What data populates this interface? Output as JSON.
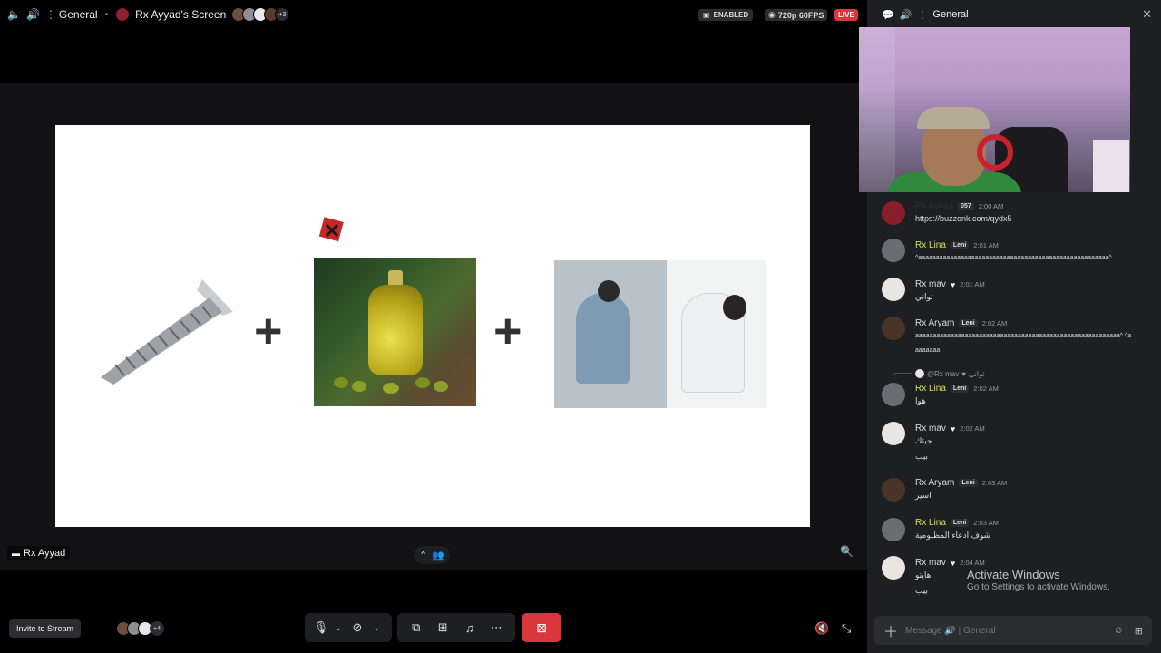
{
  "topbar": {
    "channel": "General",
    "screen_name": "Rx Ayyad's Screen",
    "viewer_extra": "+3",
    "enabled_label": "ENABLED",
    "quality_label": "720p 60FPS",
    "live_label": "LIVE"
  },
  "stage": {
    "streamer_tag": "Rx Ayyad",
    "invite_label": "Invite to Stream",
    "viewers_extra": "+4"
  },
  "chat": {
    "header_title": "General",
    "messages": [
      {
        "author": "Rx Ayyad",
        "tag": "057",
        "time": "2:00 AM",
        "body": "https://buzzonk.com/qydx5",
        "author_color": "#1e1f22",
        "body_is_link": true
      },
      {
        "author": "Rx Lina",
        "tag": "Leni",
        "time": "2:01 AM",
        "body": "^aaaaaaaaaaaaaaaaaaaaaaaaaaaaaaaaaaaaaaaaaaaaaaaaaaaaaa^",
        "author_color": "#d4e157"
      },
      {
        "author": "Rx mav",
        "heart": "♥",
        "time": "2:01 AM",
        "body": "ثواني",
        "author_color": "#dbdee1"
      },
      {
        "author": "Rx Aryam",
        "tag": "Leni",
        "time": "2:02 AM",
        "body": "aaaaaaaaaaaaaaaaaaaaaaaaaaaaaaaaaaaaaaaaaaaaaaaaaaaaaaaaaa^ ^aaaaaaaa",
        "author_color": "#dbdee1"
      },
      {
        "author": "Rx Lina",
        "tag": "Leni",
        "time": "2:02 AM",
        "body": "هوا",
        "author_color": "#d4e157",
        "reply_to": "@Rx mav",
        "reply_text": "ثواني"
      },
      {
        "author": "Rx mav",
        "heart": "♥",
        "time": "2:02 AM",
        "body": "جيتك",
        "body2": "بيب",
        "author_color": "#dbdee1"
      },
      {
        "author": "Rx Aryam",
        "tag": "Leni",
        "time": "2:03 AM",
        "body": "اسير",
        "author_color": "#dbdee1"
      },
      {
        "author": "Rx Lina",
        "tag": "Leni",
        "time": "2:03 AM",
        "body": "شوف ادعاء المظلومية",
        "author_color": "#d4e157"
      },
      {
        "author": "Rx mav",
        "heart": "♥",
        "time": "2:04 AM",
        "body": "هايتو",
        "body2": "بيب",
        "author_color": "#dbdee1"
      }
    ],
    "composer_placeholder": "Message 🔊 | General",
    "activate_title": "Activate Windows",
    "activate_sub": "Go to Settings to activate Windows."
  },
  "colors": {
    "live_red": "#da373c",
    "end_call_red": "#da373c",
    "link_blue": "#00a8fc",
    "lina_yellow": "#d4e157"
  },
  "icons": [
    "speaker-icon",
    "channel-icon",
    "chat-bubble-icon",
    "close-icon",
    "mic-icon",
    "camera-off-icon",
    "screen-share-icon",
    "activities-icon",
    "soundboard-icon",
    "more-icon",
    "end-stream-icon",
    "volume-mute-icon",
    "fullscreen-exit-icon",
    "zoom-icon",
    "plus-icon",
    "emoji-icon",
    "apps-icon"
  ]
}
